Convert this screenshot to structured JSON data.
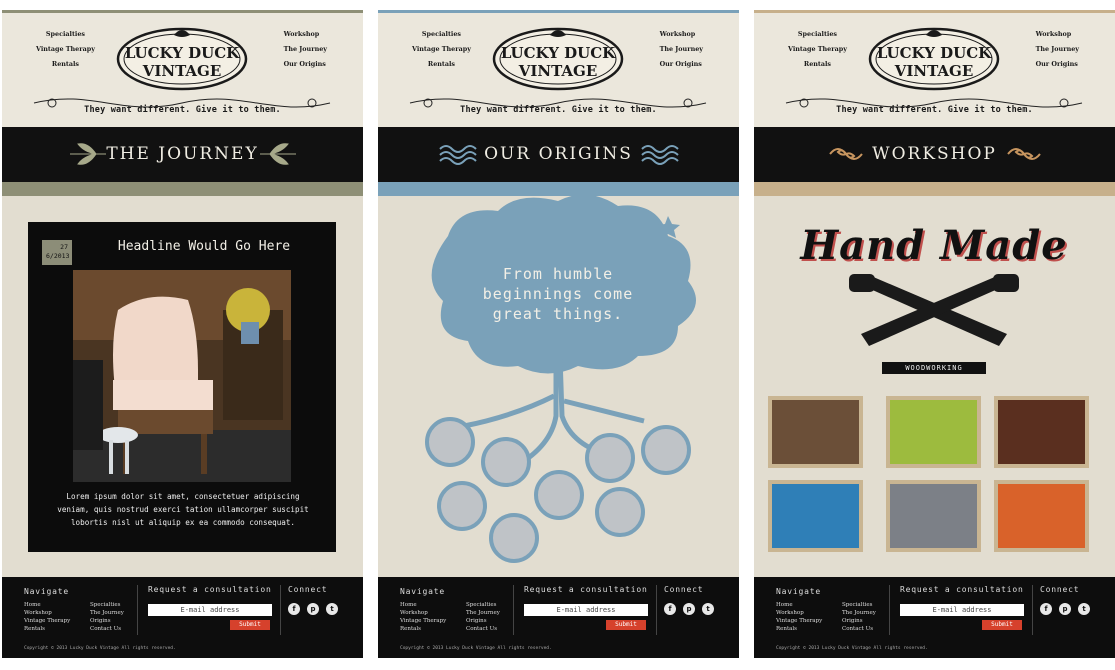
{
  "brand": {
    "line1": "LUCKY DUCK",
    "line2": "VINTAGE",
    "tagline": "They want different. Give it to them."
  },
  "nav": {
    "left": [
      "Specialties",
      "Vintage Therapy",
      "Rentals"
    ],
    "right": [
      "Workshop",
      "The Journey",
      "Our Origins"
    ]
  },
  "panels": [
    {
      "title": "THE JOURNEY",
      "accent": "#8e8f76",
      "post": {
        "day": "27",
        "month_year": "6/2013",
        "headline": "Headline Would Go Here",
        "body": "Lorem ipsum dolor sit amet, consectetuer adipiscing veniam, quis nostrud exerci tation ullamcorper suscipit lobortis nisl ut aliquip ex ea commodo consequat."
      }
    },
    {
      "title": "OUR ORIGINS",
      "accent": "#7aa1b9",
      "tree_text": [
        "From humble",
        "beginnings come",
        "great things."
      ]
    },
    {
      "title": "WORKSHOP",
      "accent": "#c7b08b",
      "hero": "Hand Made",
      "badge": "WOODWORKING"
    }
  ],
  "footer": {
    "navigate_label": "Navigate",
    "links_col1": [
      "Home",
      "Workshop",
      "Vintage Therapy",
      "Rentals"
    ],
    "links_col2": [
      "Specialties",
      "The Journey",
      "Origins",
      "Contact Us"
    ],
    "request_label": "Request a consultation",
    "email_placeholder": "E-mail address",
    "submit_label": "Submit",
    "connect_label": "Connect",
    "social": [
      "f",
      "p",
      "t"
    ],
    "copyright": "Copyright © 2013 Lucky Duck Vintage All rights reserved."
  }
}
